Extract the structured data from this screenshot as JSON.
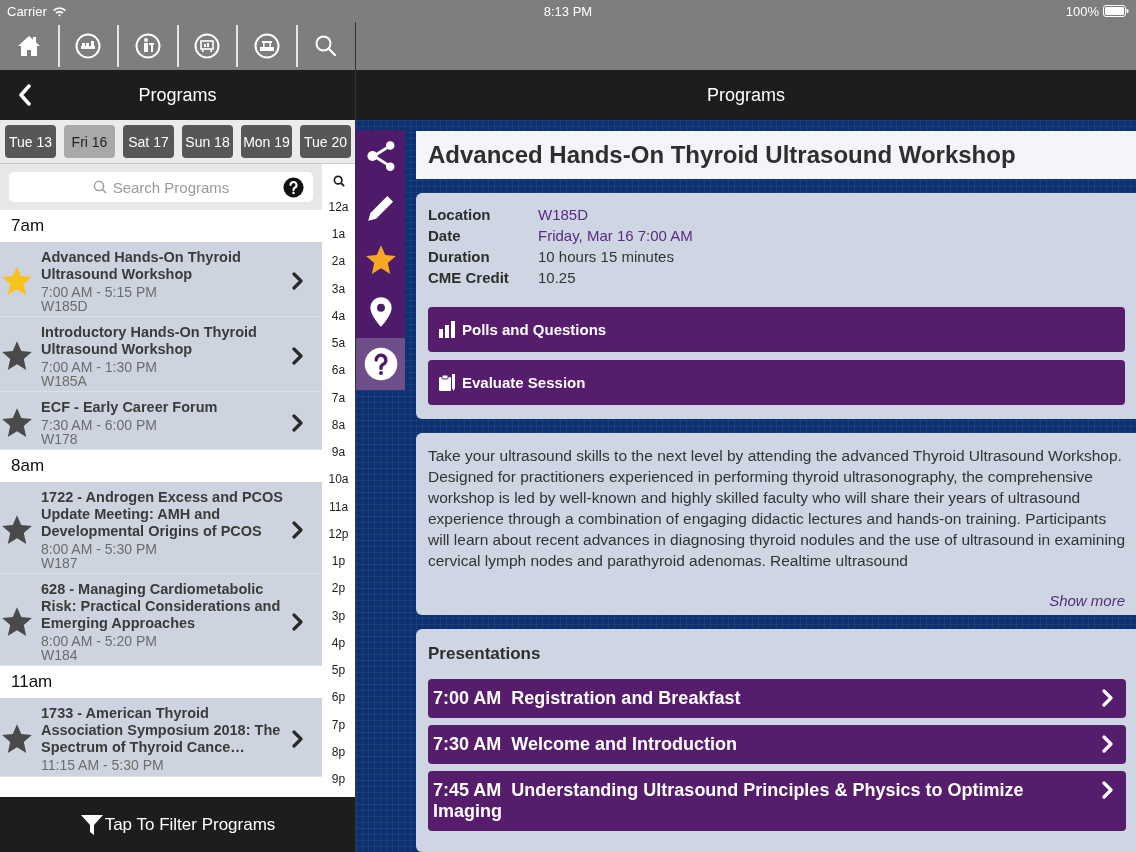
{
  "status_bar": {
    "carrier": "Carrier",
    "time": "8:13 PM",
    "battery": "100%"
  },
  "left_nav": {
    "title": "Programs"
  },
  "right_nav": {
    "title": "Programs"
  },
  "days": [
    {
      "label": "Tue 13",
      "selected": false
    },
    {
      "label": "Fri 16",
      "selected": true
    },
    {
      "label": "Sat 17",
      "selected": false
    },
    {
      "label": "Sun 18",
      "selected": false
    },
    {
      "label": "Mon 19",
      "selected": false
    },
    {
      "label": "Tue 20",
      "selected": false
    }
  ],
  "search": {
    "placeholder": "Search Programs"
  },
  "time_index": [
    "12a",
    "1a",
    "2a",
    "3a",
    "4a",
    "5a",
    "6a",
    "7a",
    "8a",
    "9a",
    "10a",
    "11a",
    "12p",
    "1p",
    "2p",
    "3p",
    "4p",
    "5p",
    "6p",
    "7p",
    "8p",
    "9p"
  ],
  "sections": [
    {
      "heading": "7am",
      "sessions": [
        {
          "title": "Advanced Hands-On Thyroid Ultrasound Workshop",
          "time": "7:00 AM - 5:15 PM",
          "room": "W185D",
          "starred": true
        },
        {
          "title": "Introductory Hands-On Thyroid Ultrasound Workshop",
          "time": "7:00 AM - 1:30 PM",
          "room": "W185A",
          "starred": false
        },
        {
          "title": "ECF - Early Career Forum",
          "time": "7:30 AM - 6:00 PM",
          "room": "W178",
          "starred": false
        }
      ]
    },
    {
      "heading": "8am",
      "sessions": [
        {
          "title": "1722 - Androgen Excess and PCOS Update Meeting: AMH and Developmental Origins of PCOS",
          "time": "8:00 AM - 5:30 PM",
          "room": "W187",
          "starred": false
        },
        {
          "title": "628 - Managing Cardiometabolic Risk: Practical Considerations and Emerging Approaches",
          "time": "8:00 AM - 5:20 PM",
          "room": "W184",
          "starred": false
        }
      ]
    },
    {
      "heading": "11am",
      "sessions": [
        {
          "title": "1733 - American Thyroid Association Symposium 2018: The Spectrum of Thyroid Cance…",
          "time": "11:15 AM - 5:30 PM",
          "starred": false
        }
      ]
    }
  ],
  "filter_bar": {
    "label": "Tap To Filter Programs"
  },
  "side_actions": [
    {
      "kind": "share",
      "selected": false
    },
    {
      "kind": "note",
      "selected": false
    },
    {
      "kind": "star",
      "selected": false
    },
    {
      "kind": "map",
      "selected": false
    },
    {
      "kind": "help",
      "selected": true
    }
  ],
  "detail": {
    "title": "Advanced Hands-On Thyroid Ultrasound Workshop",
    "starred": true,
    "fields": [
      {
        "label": "Location",
        "value": "W185D",
        "kind": "link"
      },
      {
        "label": "Date",
        "value": "Friday, Mar 16 7:00 AM",
        "kind": "link"
      },
      {
        "label": "Duration",
        "value": "10 hours 15 minutes",
        "kind": "text"
      },
      {
        "label": "CME Credit",
        "value": "10.25",
        "kind": "text"
      }
    ],
    "actions": [
      {
        "label": "Polls and Questions",
        "kind": "polls"
      },
      {
        "label": "Evaluate Session",
        "kind": "evaluate"
      }
    ],
    "description": "Take your ultrasound skills to the next level by attending the advanced Thyroid Ultrasound Workshop. Designed for practitioners experienced in performing thyroid ultrasonography, the comprehensive workshop is led by well-known and highly skilled faculty who will share their years of ultrasound experience through a combination of engaging didactic lectures and hands-on training. Participants will learn about recent advances in diagnosing thyroid nodules and the use of ultrasound in examining cervical lymph nodes and parathyroid adenomas. Realtime ultrasound",
    "show_more": "Show more",
    "presentations": {
      "heading": "Presentations",
      "items": [
        {
          "time": "7:00 AM",
          "title": "Registration and Breakfast"
        },
        {
          "time": "7:30 AM",
          "title": "Welcome and Introduction"
        },
        {
          "time": "7:45 AM",
          "title": "Understanding Ultrasound Principles & Physics to Optimize Imaging"
        }
      ]
    }
  }
}
